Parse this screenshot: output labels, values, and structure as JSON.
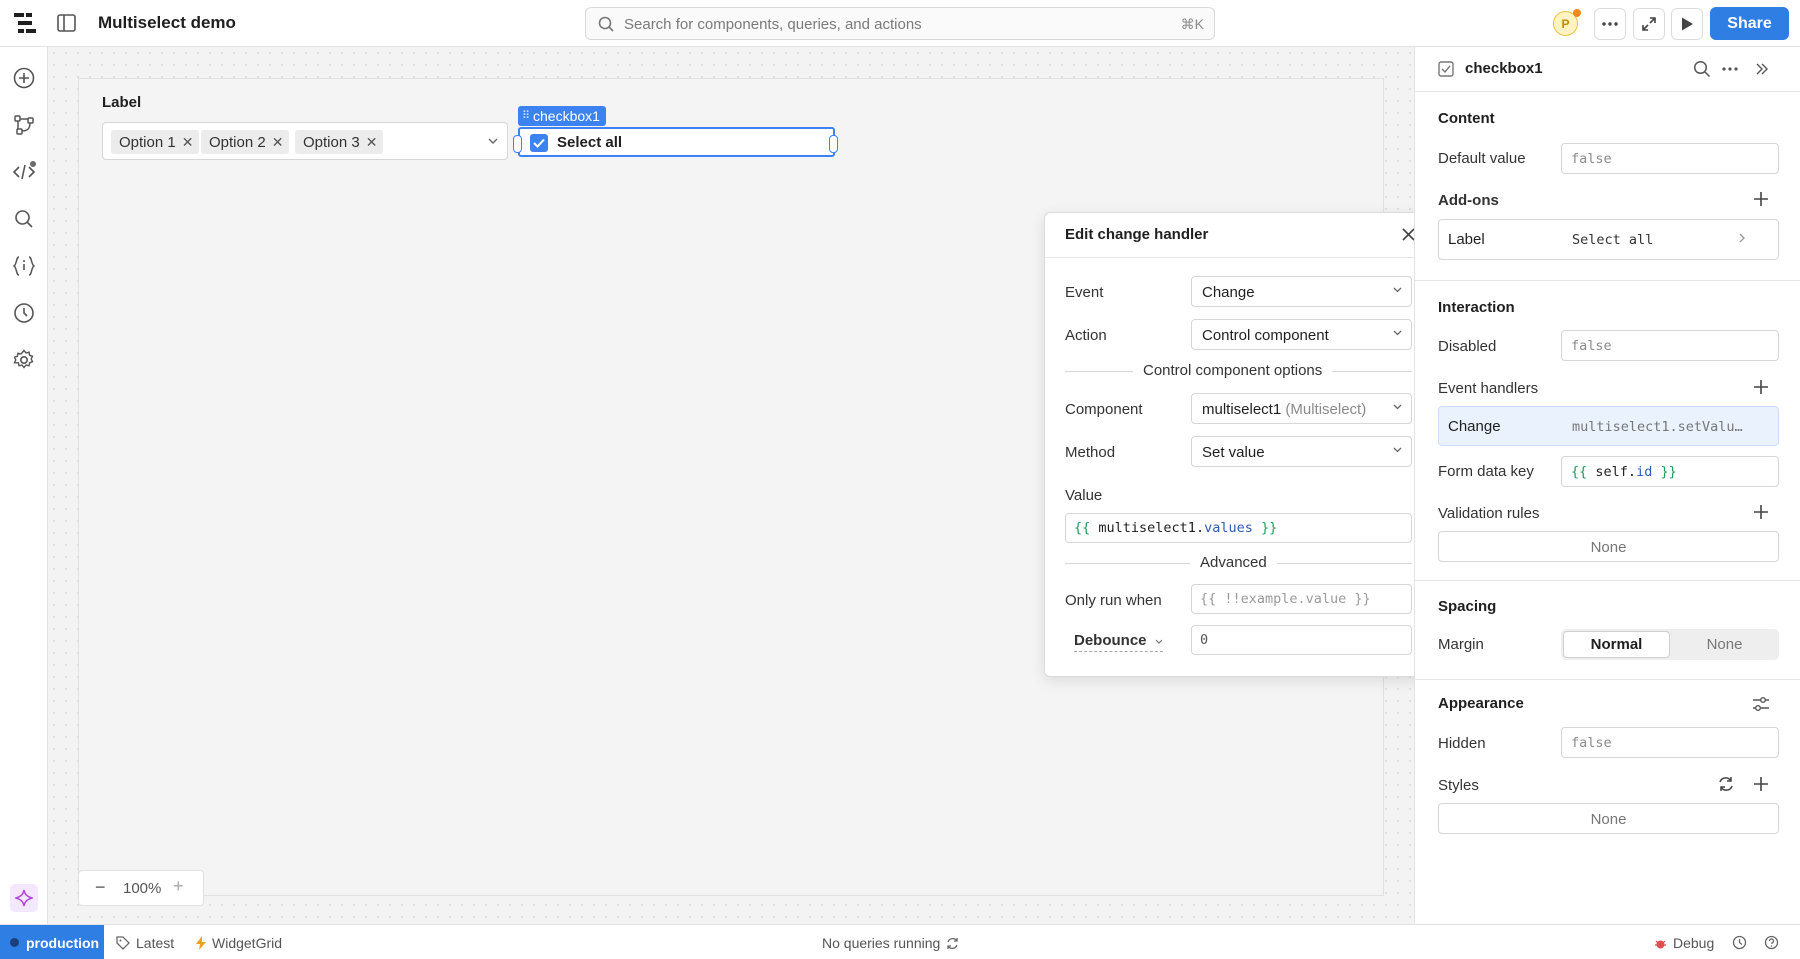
{
  "app": {
    "title": "Multiselect demo",
    "avatar_initial": "P",
    "share_label": "Share"
  },
  "search": {
    "placeholder": "Search for components, queries, and actions",
    "shortcut": "⌘K"
  },
  "canvas": {
    "multiselect": {
      "label": "Label",
      "tags": [
        "Option 1",
        "Option 2",
        "Option 3"
      ]
    },
    "checkbox": {
      "tag": "checkbox1",
      "label": "Select all",
      "checked": true
    },
    "zoom": "100%"
  },
  "popover": {
    "title": "Edit change handler",
    "event_label": "Event",
    "event_value": "Change",
    "action_label": "Action",
    "action_value": "Control component",
    "section_control": "Control component options",
    "component_label": "Component",
    "component_value": "multiselect1",
    "component_type": "(Multiselect)",
    "method_label": "Method",
    "method_value": "Set value",
    "value_label": "Value",
    "value_code": {
      "open": "{{",
      "obj": "multiselect1",
      "dot": ".",
      "prop": "values",
      "close": "}}"
    },
    "section_advanced": "Advanced",
    "only_run_label": "Only run when",
    "only_run_placeholder": "{{ !!example.value }}",
    "debounce_label": "Debounce",
    "debounce_value": "0"
  },
  "inspector": {
    "component_name": "checkbox1",
    "content_head": "Content",
    "default_value_label": "Default value",
    "default_value": "false",
    "addons_head": "Add-ons",
    "addon_label": "Label",
    "addon_value": "Select all",
    "interaction_head": "Interaction",
    "disabled_label": "Disabled",
    "disabled_value": "false",
    "event_handlers_head": "Event handlers",
    "handler_event": "Change",
    "handler_action": "multiselect1.setValu…",
    "form_key_label": "Form data key",
    "form_key_code": {
      "open": "{{",
      "obj": "self",
      "dot": ".",
      "prop": "id",
      "close": "}}"
    },
    "validation_head": "Validation rules",
    "validation_value": "None",
    "spacing_head": "Spacing",
    "margin_label": "Margin",
    "margin_options": [
      "Normal",
      "None"
    ],
    "margin_selected": "Normal",
    "appearance_head": "Appearance",
    "hidden_label": "Hidden",
    "hidden_value": "false",
    "styles_head": "Styles",
    "styles_value": "None"
  },
  "status": {
    "environment": "production",
    "version": "Latest",
    "layout": "WidgetGrid",
    "queries": "No queries running",
    "debug": "Debug"
  },
  "colors": {
    "accent": "#2f7ee3",
    "checkbox": "#3c82f0",
    "code_green": "#1a9c5a",
    "code_blue": "#2c5bb5",
    "handler_bg": "#eaf2fd"
  }
}
